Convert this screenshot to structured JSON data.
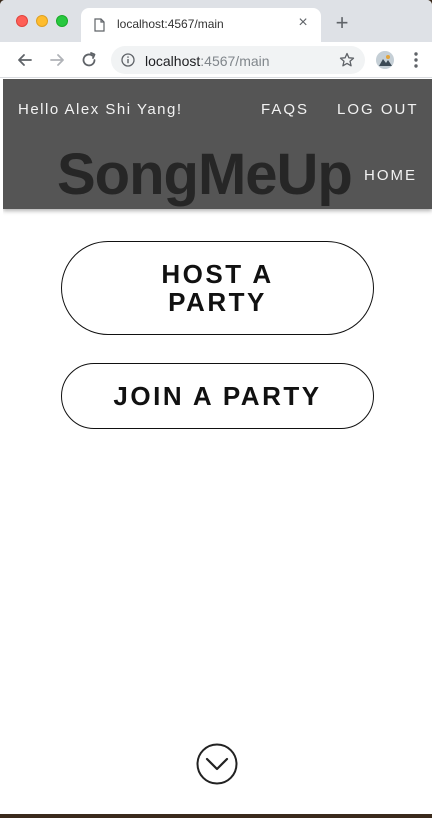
{
  "browser": {
    "tab_title": "localhost:4567/main",
    "new_tab_symbol": "+",
    "close_tab_symbol": "×",
    "url_host": "localhost",
    "url_path": ":4567/main"
  },
  "header": {
    "greeting": "Hello Alex Shi Yang!",
    "faqs": "FAQS",
    "logout": "LOG OUT",
    "home": "HOME",
    "brand": "SongMeUp",
    "background_color": "#555555"
  },
  "main": {
    "host_label": "HOST A PARTY",
    "join_label": "JOIN A PARTY"
  },
  "icons": {
    "scroll": "chevron-down-circle-icon"
  }
}
